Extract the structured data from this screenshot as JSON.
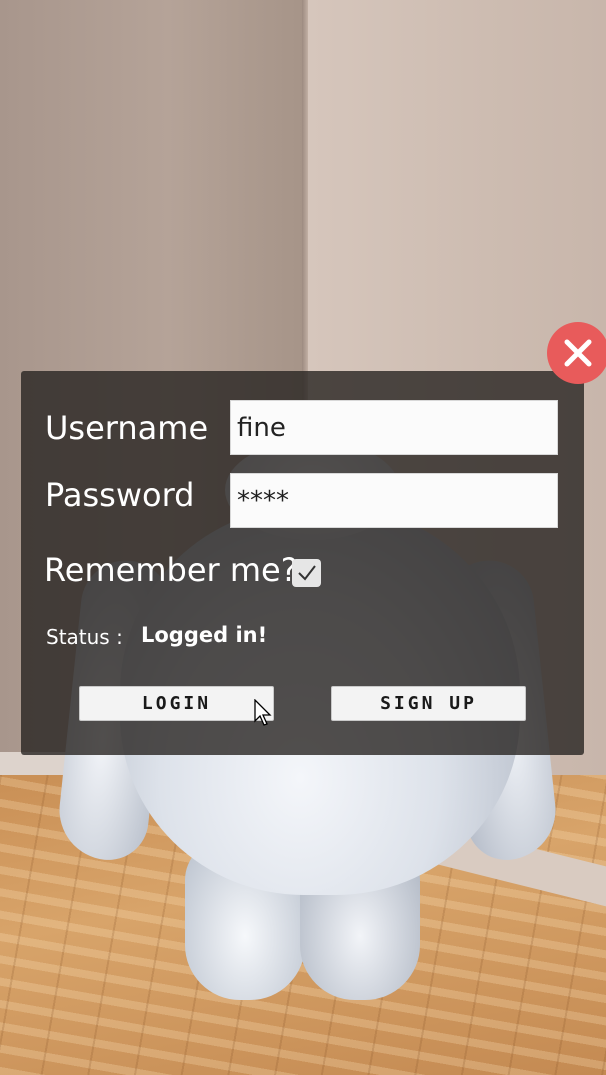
{
  "login_form": {
    "username_label": "Username",
    "password_label": "Password",
    "username_value": "fine",
    "password_value": "****",
    "remember_label": "Remember me?",
    "remember_checked": true,
    "status_label": "Status :",
    "status_value": "Logged in!",
    "login_button": "LOGIN",
    "signup_button": "SIGN UP"
  },
  "icons": {
    "close": "close-icon",
    "checkmark": "checkmark-icon",
    "cursor": "mouse-cursor-icon"
  },
  "colors": {
    "close_button": "#e85b5b",
    "panel_background": "#282422"
  }
}
